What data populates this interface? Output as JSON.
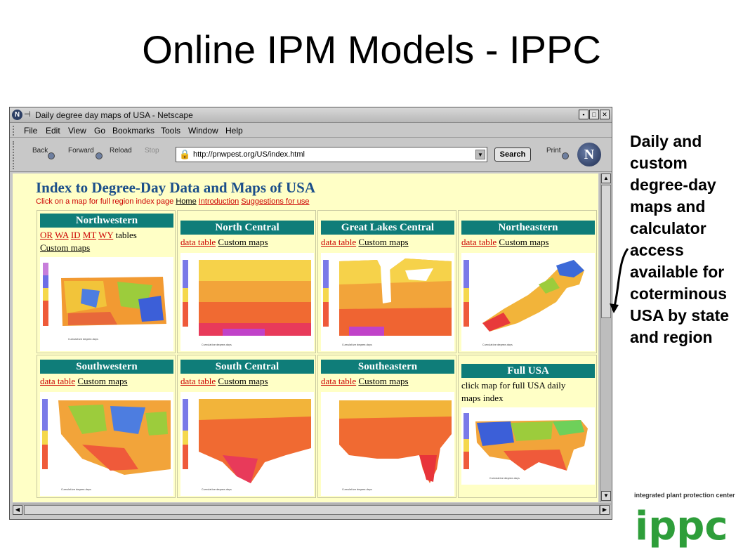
{
  "slide": {
    "title": "Online IPM Models - IPPC",
    "side_text": "Daily and custom degree-day maps and calculator access available for coterminous USA by state and region",
    "logo_text": "integrated plant protection center",
    "logo_mark": "ippc"
  },
  "browser": {
    "window_title": "Daily degree day maps of USA - Netscape",
    "menu": [
      "File",
      "Edit",
      "View",
      "Go",
      "Bookmarks",
      "Tools",
      "Window",
      "Help"
    ],
    "toolbar": {
      "back": "Back",
      "forward": "Forward",
      "reload": "Reload",
      "stop": "Stop",
      "url": "http://pnwpest.org/US/index.html",
      "search": "Search",
      "print": "Print"
    },
    "window_buttons": [
      "▪",
      "□",
      "✕"
    ]
  },
  "page": {
    "heading": "Index to Degree-Day Data and Maps of USA",
    "subtitle": "Click on a map for full region index page",
    "links": {
      "home": "Home",
      "introduction": "Introduction",
      "suggestions": "Suggestions for use"
    },
    "regions": [
      {
        "name": "Northwestern",
        "links": [
          "OR",
          "WA",
          "ID",
          "MT",
          "WY"
        ],
        "extra": "tables",
        "custom": "Custom maps"
      },
      {
        "name": "North Central",
        "data": "data table",
        "custom": "Custom maps"
      },
      {
        "name": "Great Lakes Central",
        "data": "data table",
        "custom": "Custom maps"
      },
      {
        "name": "Northeastern",
        "data": "data table",
        "custom": "Custom maps"
      },
      {
        "name": "Southwestern",
        "data": "data table",
        "custom": "Custom maps"
      },
      {
        "name": "South Central",
        "data": "data table",
        "custom": "Custom maps"
      },
      {
        "name": "Southeastern",
        "data": "data table",
        "custom": "Custom maps"
      },
      {
        "name": "Full USA",
        "note_line1": "click map for full USA daily",
        "note_line2": "maps index"
      }
    ]
  },
  "colors": {
    "page_bg": "#ffffc6",
    "region_header": "#0f7d79",
    "link_red": "#cc0000",
    "heading_blue": "#1c4f8a",
    "ippc_green": "#2e9e3a",
    "ippc_teal": "#2aa6a6"
  },
  "icons": {
    "lock": "padlock-icon",
    "dropdown": "chevron-down-icon",
    "throbber": "netscape-logo-icon"
  }
}
